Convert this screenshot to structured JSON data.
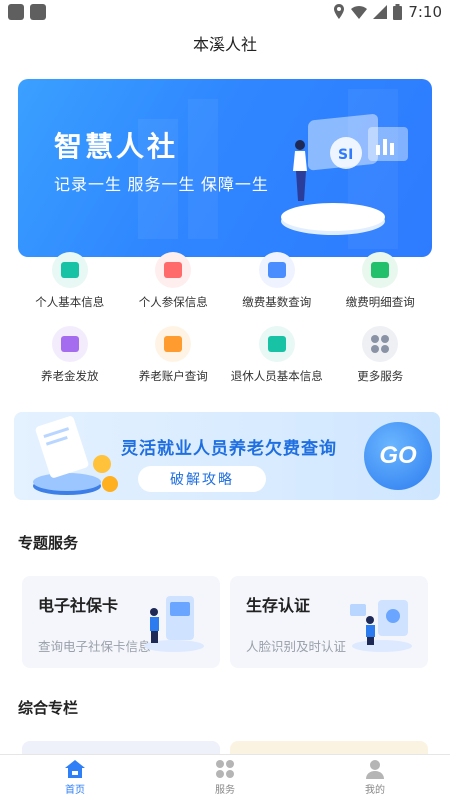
{
  "status_bar": {
    "time": "7:10"
  },
  "header": {
    "title": "本溪人社"
  },
  "banner": {
    "title": "智慧人社",
    "subtitle": "记录一生  服务一生  保障一生"
  },
  "grid": [
    [
      {
        "label": "个人基本信息",
        "icon": "id-card-icon",
        "color": "#17c3a4",
        "bg": "#e8f8f4"
      },
      {
        "label": "个人参保信息",
        "icon": "insurance-card-icon",
        "color": "#ff6a6a",
        "bg": "#ffeeee"
      },
      {
        "label": "缴费基数查询",
        "icon": "yen-card-icon",
        "color": "#4a8dff",
        "bg": "#eef3ff"
      },
      {
        "label": "缴费明细查询",
        "icon": "detail-list-icon",
        "color": "#23c06b",
        "bg": "#e9f8ef"
      }
    ],
    [
      {
        "label": "养老金发放",
        "icon": "pension-icon",
        "color": "#a56cf0",
        "bg": "#f3ecfd"
      },
      {
        "label": "养老账户查询",
        "icon": "account-icon",
        "color": "#ff9b2f",
        "bg": "#fff3e6"
      },
      {
        "label": "退休人员基本信息",
        "icon": "retiree-icon",
        "color": "#17c3a4",
        "bg": "#e8f8f4"
      },
      {
        "label": "更多服务",
        "icon": "more-services-icon",
        "color": "#8a93a6",
        "bg": "#eef0f4"
      }
    ]
  ],
  "promo": {
    "title": "灵活就业人员养老欠费查询",
    "button": "破解攻略",
    "go": "GO"
  },
  "section_special": {
    "title": "专题服务"
  },
  "services": [
    {
      "title": "电子社保卡",
      "subtitle": "查询电子社保卡信息"
    },
    {
      "title": "生存认证",
      "subtitle": "人脸识别及时认证"
    }
  ],
  "section_general": {
    "title": "综合专栏"
  },
  "tabs": [
    {
      "label": "首页",
      "icon": "home-icon",
      "active": true
    },
    {
      "label": "服务",
      "icon": "services-grid-icon",
      "active": false
    },
    {
      "label": "我的",
      "icon": "profile-icon",
      "active": false
    }
  ],
  "colors": {
    "accent": "#2f7ff7",
    "banner": "#2e86ff",
    "promo_text": "#1f6fe0"
  }
}
